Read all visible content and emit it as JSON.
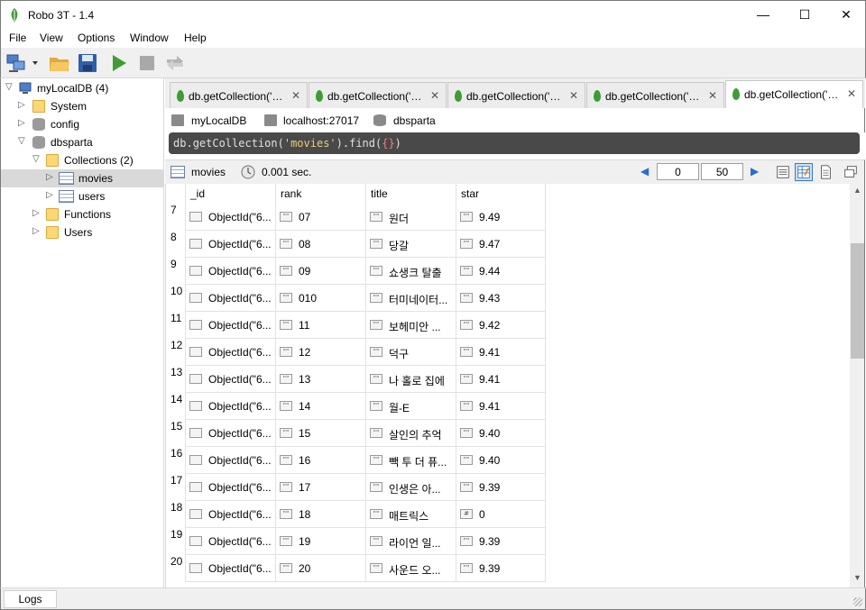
{
  "window": {
    "title": "Robo 3T - 1.4",
    "min": "—",
    "max": "☐",
    "close": "✕"
  },
  "menu": [
    "File",
    "View",
    "Options",
    "Window",
    "Help"
  ],
  "tree": {
    "connection": "myLocalDB (4)",
    "system": "System",
    "config": "config",
    "dbsparta": "dbsparta",
    "collections": "Collections (2)",
    "movies": "movies",
    "users": "users",
    "functions": "Functions",
    "users_folder": "Users"
  },
  "tabs": [
    "db.getCollection('…",
    "db.getCollection('…",
    "db.getCollection('…",
    "db.getCollection('…",
    "db.getCollection('…"
  ],
  "tab_close": "✕",
  "breadcrumb": {
    "connection": "myLocalDB",
    "host": "localhost:27017",
    "database": "dbsparta"
  },
  "query": {
    "prefix": "db.",
    "fn": "getCollection(",
    "arg": "'movies'",
    "mid": ").find(",
    "braces": "{}",
    "suffix": ")"
  },
  "result": {
    "collection": "movies",
    "time": "0.001 sec.",
    "page_start": "0",
    "page_size": "50",
    "prev": "◀",
    "next": "▶"
  },
  "grid": {
    "columns": [
      "_id",
      "rank",
      "title",
      "star"
    ],
    "rows": [
      {
        "n": "7",
        "id": "ObjectId(\"6...",
        "rank": "07",
        "title": "원더",
        "star": "9.49",
        "star_type": "\"\""
      },
      {
        "n": "8",
        "id": "ObjectId(\"6...",
        "rank": "08",
        "title": "당갈",
        "star": "9.47",
        "star_type": "\"\""
      },
      {
        "n": "9",
        "id": "ObjectId(\"6...",
        "rank": "09",
        "title": "쇼생크 탈출",
        "star": "9.44",
        "star_type": "\"\""
      },
      {
        "n": "10",
        "id": "ObjectId(\"6...",
        "rank": "010",
        "title": "터미네이터...",
        "star": "9.43",
        "star_type": "\"\""
      },
      {
        "n": "11",
        "id": "ObjectId(\"6...",
        "rank": "11",
        "title": "보헤미안 ...",
        "star": "9.42",
        "star_type": "\"\""
      },
      {
        "n": "12",
        "id": "ObjectId(\"6...",
        "rank": "12",
        "title": "덕구",
        "star": "9.41",
        "star_type": "\"\""
      },
      {
        "n": "13",
        "id": "ObjectId(\"6...",
        "rank": "13",
        "title": "나 홀로 집에",
        "star": "9.41",
        "star_type": "\"\""
      },
      {
        "n": "14",
        "id": "ObjectId(\"6...",
        "rank": "14",
        "title": "월-E",
        "star": "9.41",
        "star_type": "\"\""
      },
      {
        "n": "15",
        "id": "ObjectId(\"6...",
        "rank": "15",
        "title": "살인의 추억",
        "star": "9.40",
        "star_type": "\"\""
      },
      {
        "n": "16",
        "id": "ObjectId(\"6...",
        "rank": "16",
        "title": "빽 투 더 퓨...",
        "star": "9.40",
        "star_type": "\"\""
      },
      {
        "n": "17",
        "id": "ObjectId(\"6...",
        "rank": "17",
        "title": "인생은 아...",
        "star": "9.39",
        "star_type": "\"\""
      },
      {
        "n": "18",
        "id": "ObjectId(\"6...",
        "rank": "18",
        "title": "매트릭스",
        "star": "0",
        "star_type": "#"
      },
      {
        "n": "19",
        "id": "ObjectId(\"6...",
        "rank": "19",
        "title": "라이언 일...",
        "star": "9.39",
        "star_type": "\"\""
      },
      {
        "n": "20",
        "id": "ObjectId(\"6...",
        "rank": "20",
        "title": "사운드 오...",
        "star": "9.39",
        "star_type": "\"\""
      }
    ],
    "str_badge": "\"\""
  },
  "status": {
    "logs": "Logs"
  },
  "colors": {
    "accent": "#3a78c3",
    "leaf": "#3f9c35",
    "editor_bg": "#494949"
  }
}
